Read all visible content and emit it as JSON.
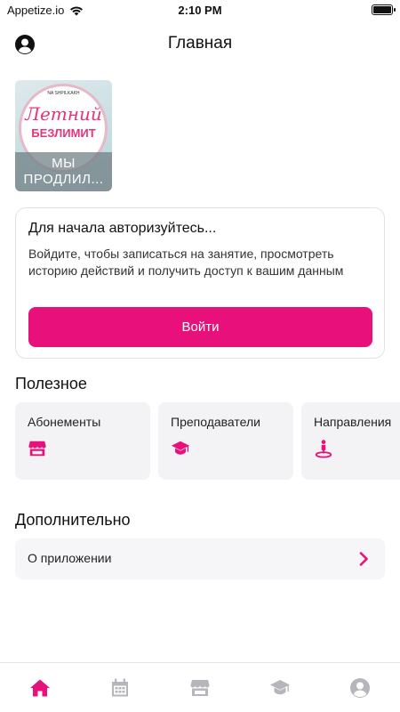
{
  "status_bar": {
    "carrier": "Appetize.io",
    "time": "2:10 PM"
  },
  "header": {
    "title": "Главная"
  },
  "promo": {
    "brand": "NA SHPILKAKH",
    "script_text": "Летний",
    "bold_text": "БЕЗЛИМИТ",
    "caption": "МЫ ПРОДЛИЛ..."
  },
  "auth": {
    "title": "Для начала авторизуйтесь...",
    "text": "Войдите, чтобы записаться на занятие, просмотреть историю действий и получить доступ к вашим данным",
    "login_label": "Войти"
  },
  "useful": {
    "title": "Полезное",
    "tiles": [
      {
        "label": "Абонементы",
        "icon": "store-icon"
      },
      {
        "label": "Преподаватели",
        "icon": "graduation-cap-icon"
      },
      {
        "label": "Направления",
        "icon": "person-pin-icon"
      }
    ]
  },
  "extra": {
    "title": "Дополнительно",
    "items": [
      {
        "label": "О приложении",
        "icon": "chevron-right-icon"
      }
    ]
  },
  "tabbar": {
    "tabs": [
      {
        "icon": "home-icon",
        "active": true
      },
      {
        "icon": "calendar-icon",
        "active": false
      },
      {
        "icon": "store-icon",
        "active": false
      },
      {
        "icon": "graduation-cap-icon",
        "active": false
      },
      {
        "icon": "user-icon",
        "active": false
      }
    ]
  },
  "colors": {
    "accent": "#e8117b",
    "inactive_icon": "#b5b5bb",
    "card_bg": "#f3f3f5"
  }
}
